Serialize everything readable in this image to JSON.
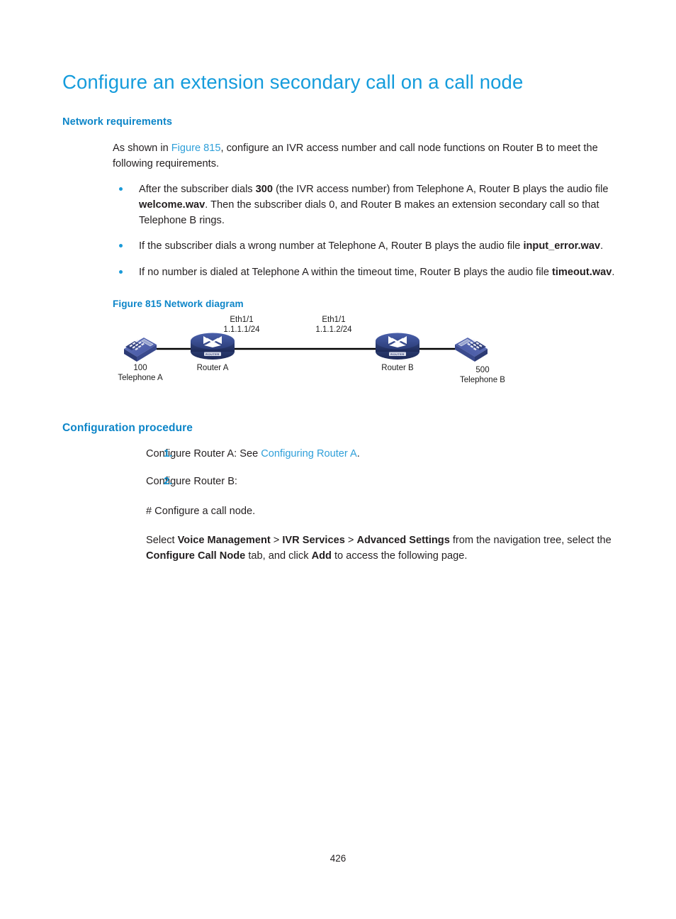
{
  "document": {
    "title": "Configure an extension secondary call on a call node",
    "page_number": "426"
  },
  "sections": {
    "network_requirements": {
      "heading": "Network requirements",
      "intro_pre": "As shown in ",
      "intro_xref": "Figure 815",
      "intro_post": ", configure an IVR access number and call node functions on Router B to meet the following requirements.",
      "bullets": [
        {
          "parts": [
            {
              "text": "After the subscriber dials ",
              "bold": false
            },
            {
              "text": "300",
              "bold": true
            },
            {
              "text": " (the IVR access number) from Telephone A, Router B plays the audio file ",
              "bold": false
            },
            {
              "text": "welcome.wav",
              "bold": true
            },
            {
              "text": ". Then the subscriber dials 0, and Router B makes an extension secondary call so that Telephone B rings.",
              "bold": false
            }
          ]
        },
        {
          "parts": [
            {
              "text": "If the subscriber dials a wrong number at Telephone A, Router B plays the audio file ",
              "bold": false
            },
            {
              "text": "input_error.wav",
              "bold": true
            },
            {
              "text": ".",
              "bold": false
            }
          ]
        },
        {
          "parts": [
            {
              "text": "If no number is dialed at Telephone A within the timeout time, Router B plays the audio file ",
              "bold": false
            },
            {
              "text": "timeout.wav",
              "bold": true
            },
            {
              "text": ".",
              "bold": false
            }
          ]
        }
      ]
    },
    "figure": {
      "caption_number": "Figure 815",
      "caption_text": "Network diagram",
      "caption_full": "Figure 815 Network diagram",
      "nodes": [
        {
          "name": "telephone-a",
          "type": "telephone",
          "label_top": "100",
          "label_bottom": "Telephone A"
        },
        {
          "name": "router-a",
          "type": "router",
          "label": "Router A",
          "icon_text": "ROUTER"
        },
        {
          "name": "router-b",
          "type": "router",
          "label": "Router B",
          "icon_text": "ROUTER"
        },
        {
          "name": "telephone-b",
          "type": "telephone",
          "label_top": "500",
          "label_bottom": "Telephone B"
        }
      ],
      "interface_labels": [
        {
          "name": "router-a-eth",
          "line1": "Eth1/1",
          "line2": "1.1.1.1/24"
        },
        {
          "name": "router-b-eth",
          "line1": "Eth1/1",
          "line2": "1.1.1.2/24"
        }
      ],
      "colors": {
        "router_fill_dark": "#2a3c78",
        "router_fill_mid": "#3c52a0",
        "telephone_body": "#3d4c92",
        "telephone_top": "#5b6bb5",
        "link_line": "#000000"
      }
    },
    "configuration_procedure": {
      "heading": "Configuration procedure",
      "steps": [
        {
          "num": "1.",
          "parts": [
            {
              "text": "Configure Router A: See ",
              "bold": false,
              "link": false
            },
            {
              "text": "Configuring Router A",
              "bold": false,
              "link": true
            },
            {
              "text": ".",
              "bold": false,
              "link": false
            }
          ]
        },
        {
          "num": "2.",
          "parts": [
            {
              "text": "Configure Router B:",
              "bold": false,
              "link": false
            }
          ],
          "sub_paragraphs": [
            {
              "name": "comment-line",
              "parts": [
                {
                  "text": "# Configure a call node.",
                  "bold": false
                }
              ]
            },
            {
              "name": "navigation-instruction",
              "parts": [
                {
                  "text": "Select ",
                  "bold": false
                },
                {
                  "text": "Voice Management",
                  "bold": true
                },
                {
                  "text": " > ",
                  "bold": false
                },
                {
                  "text": "IVR Services",
                  "bold": true
                },
                {
                  "text": " > ",
                  "bold": false
                },
                {
                  "text": "Advanced Settings",
                  "bold": true
                },
                {
                  "text": " from the navigation tree, select the ",
                  "bold": false
                },
                {
                  "text": "Configure Call Node",
                  "bold": true
                },
                {
                  "text": " tab, and click ",
                  "bold": false
                },
                {
                  "text": "Add",
                  "bold": true
                },
                {
                  "text": " to access the following page.",
                  "bold": false
                }
              ]
            }
          ]
        }
      ]
    }
  },
  "theme": {
    "title_blue": "#159cdc",
    "heading_blue": "#0c85c8",
    "link_blue": "#2e9fd9",
    "bullet_blue": "#1a9ad8",
    "body_text": "#231f20",
    "page_background": "#ffffff"
  }
}
